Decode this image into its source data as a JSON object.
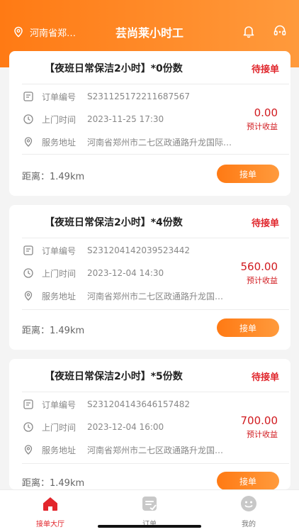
{
  "header": {
    "location": "河南省郑…",
    "title": "芸尚莱小时工",
    "icons": {
      "location": "location-pin-icon",
      "bell": "bell-icon",
      "service": "headset-icon"
    }
  },
  "orders": [
    {
      "title": "【夜班日常保洁2小时】*0份数",
      "status": "待接单",
      "order_no_label": "订单编号",
      "order_no": "S231125172211687567",
      "time_label": "上门时间",
      "time": "2023-11-25 17:30",
      "addr_label": "服务地址",
      "addr": "河南省郑州市二七区政通路升龙国际…",
      "amount": "0.00",
      "amount_label": "预计收益",
      "distance": "距离：1.49km",
      "button": "接单"
    },
    {
      "title": "【夜班日常保洁2小时】*4份数",
      "status": "待接单",
      "order_no_label": "订单编号",
      "order_no": "S231204142039523442",
      "time_label": "上门时间",
      "time": "2023-12-04 14:30",
      "addr_label": "服务地址",
      "addr": "河南省郑州市二七区政通路升龙国…",
      "amount": "560.00",
      "amount_label": "预计收益",
      "distance": "距离：1.49km",
      "button": "接单"
    },
    {
      "title": "【夜班日常保洁2小时】*5份数",
      "status": "待接单",
      "order_no_label": "订单编号",
      "order_no": "S231204143646157482",
      "time_label": "上门时间",
      "time": "2023-12-04 16:00",
      "addr_label": "服务地址",
      "addr": "河南省郑州市二七区政通路升龙国…",
      "amount": "700.00",
      "amount_label": "预计收益",
      "distance": "距离：1.49km",
      "button": "接单"
    }
  ],
  "tabs": [
    {
      "label": "接单大厅",
      "icon": "home-icon",
      "active": true
    },
    {
      "label": "订单",
      "icon": "order-icon",
      "active": false
    },
    {
      "label": "我的",
      "icon": "profile-icon",
      "active": false
    }
  ],
  "colors": {
    "brand": "#ff7a14",
    "accent_red": "#e0262c"
  }
}
